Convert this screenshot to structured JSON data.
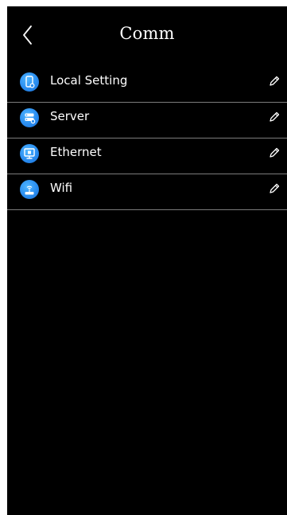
{
  "header": {
    "title": "Comm",
    "back_icon": "back-chevron-icon"
  },
  "menu": {
    "items": [
      {
        "label": "Local Setting",
        "icon": "local-setting-icon",
        "action_icon": "edit-pencil-icon"
      },
      {
        "label": "Server",
        "icon": "server-icon",
        "action_icon": "edit-pencil-icon"
      },
      {
        "label": "Ethernet",
        "icon": "ethernet-icon",
        "action_icon": "edit-pencil-icon"
      },
      {
        "label": "Wifi",
        "icon": "wifi-icon",
        "action_icon": "edit-pencil-icon"
      }
    ]
  },
  "colors": {
    "background": "#000000",
    "text": "#ffffff",
    "divider": "#7c7c7c",
    "icon_accent": "#2a8df0"
  }
}
